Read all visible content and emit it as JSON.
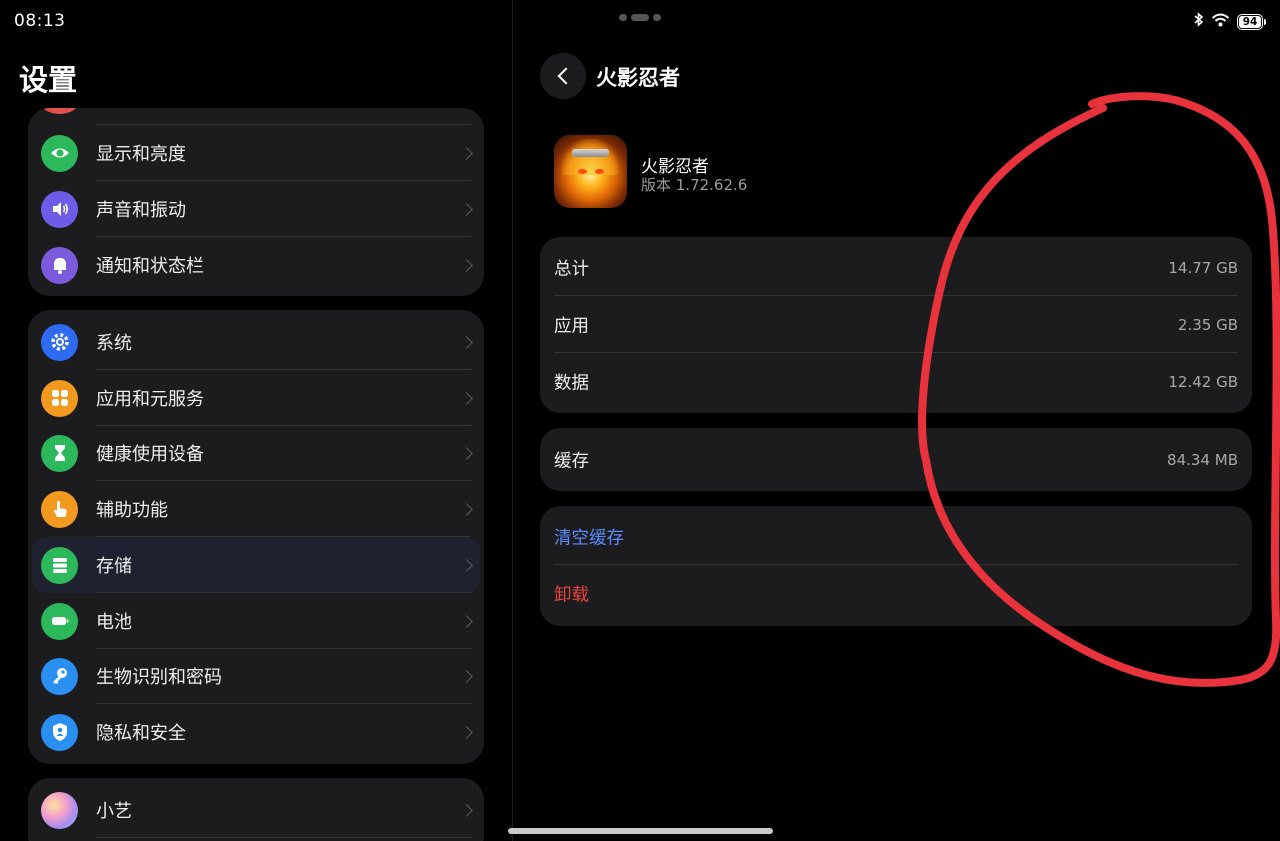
{
  "status_bar": {
    "time": "08:13",
    "battery": "94",
    "icons": [
      "bluetooth-icon",
      "wifi-icon",
      "battery-icon"
    ]
  },
  "left_panel": {
    "title": "设置",
    "groups": [
      {
        "items": [
          {
            "label": "显示和亮度",
            "icon": "eye-icon",
            "color": "#2eb85c"
          },
          {
            "label": "声音和振动",
            "icon": "speaker-icon",
            "color": "#6c5ce7"
          },
          {
            "label": "通知和状态栏",
            "icon": "bell-icon",
            "color": "#7b5bdc"
          }
        ]
      },
      {
        "items": [
          {
            "label": "系统",
            "icon": "gear-icon",
            "color": "#2f6bf2"
          },
          {
            "label": "应用和元服务",
            "icon": "apps-grid-icon",
            "color": "#f29a1f"
          },
          {
            "label": "健康使用设备",
            "icon": "hourglass-icon",
            "color": "#2eb85c"
          },
          {
            "label": "辅助功能",
            "icon": "hand-pointer-icon",
            "color": "#f29a1f"
          },
          {
            "label": "存储",
            "icon": "storage-icon",
            "color": "#2eb85c",
            "selected": true
          },
          {
            "label": "电池",
            "icon": "battery-icon",
            "color": "#2eb85c"
          },
          {
            "label": "生物识别和密码",
            "icon": "key-icon",
            "color": "#2a8ff0"
          },
          {
            "label": "隐私和安全",
            "icon": "shield-user-icon",
            "color": "#2a8ff0"
          }
        ]
      },
      {
        "items": [
          {
            "label": "小艺",
            "icon": "celia-orb-icon",
            "color": "#c99bd9"
          }
        ]
      }
    ]
  },
  "right_panel": {
    "title": "火影忍者",
    "app": {
      "name": "火影忍者",
      "version": "版本 1.72.62.6",
      "icon": "naruto-app-icon"
    },
    "storage_rows": [
      {
        "label": "总计",
        "value": "14.77 GB"
      },
      {
        "label": "应用",
        "value": "2.35 GB"
      },
      {
        "label": "数据",
        "value": "12.42 GB"
      }
    ],
    "cache_row": {
      "label": "缓存",
      "value": "84.34 MB"
    },
    "actions": {
      "clear_cache": "清空缓存",
      "uninstall": "卸载"
    },
    "colors": {
      "action_blue": "#5b8cff",
      "action_red": "#e6463c",
      "annotation_red": "#e8333c"
    }
  }
}
